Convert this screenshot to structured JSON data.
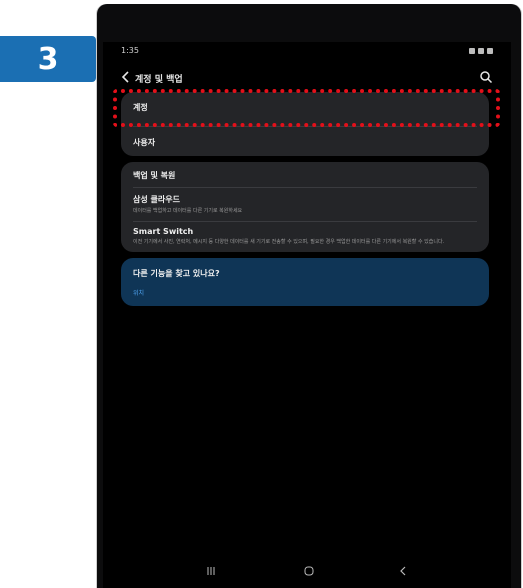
{
  "step_badge": "3",
  "status_bar": {
    "time": "1:35"
  },
  "header": {
    "back_icon": "chevron-left-icon",
    "title": "계정 및 백업",
    "search_icon": "search-icon"
  },
  "account_group": {
    "items": [
      {
        "label": "계정"
      },
      {
        "label": "사용자"
      }
    ]
  },
  "backup_group": {
    "header": "백업 및 복원",
    "items": [
      {
        "title": "삼성 클라우드",
        "subtitle": "데이터를 백업하고 데이터를 다른 기기로 복원하세요"
      },
      {
        "title": "Smart Switch",
        "subtitle": "이전 기기에서 사진, 연락처, 메시지 등 다양한 데이터를 새 기기로 전송할 수 있으며, 필요한 경우 백업한 데이터를 다른 기기에서 복원할 수 있습니다."
      }
    ]
  },
  "suggestion": {
    "title": "다른 기능을 찾고 있나요?",
    "link": "위치"
  },
  "highlight_color": "#e3101a",
  "badge_color": "#1b6fb3"
}
